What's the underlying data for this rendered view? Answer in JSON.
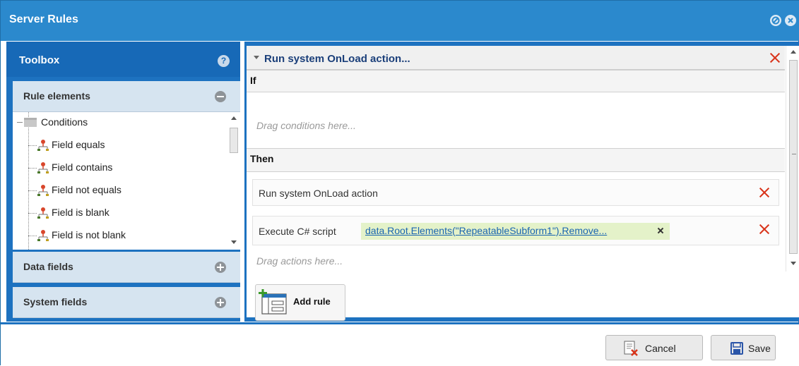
{
  "window": {
    "title": "Server Rules"
  },
  "toolbox": {
    "title": "Toolbox",
    "help_glyph": "?",
    "sections": {
      "rule_elements": "Rule elements",
      "data_fields": "Data fields",
      "system_fields": "System fields"
    },
    "tree": {
      "folder": "Conditions",
      "items": [
        "Field equals",
        "Field contains",
        "Field not equals",
        "Field is blank",
        "Field is not blank"
      ]
    }
  },
  "rule": {
    "name": "Run system OnLoad action...",
    "if_label": "If",
    "conditions_hint": "Drag conditions here...",
    "then_label": "Then",
    "actions": [
      {
        "label": "Run system OnLoad action"
      },
      {
        "label": "Execute C# script",
        "script": "data.Root.Elements(\"RepeatableSubform1\").Remove..."
      }
    ],
    "actions_hint": "Drag actions here..."
  },
  "add_rule_label": "Add rule",
  "footer": {
    "cancel_label": "Cancel",
    "save_label": "Save"
  },
  "colors": {
    "titlebar": "#2b89cd",
    "panel": "#1d72c0",
    "delete": "#d9341b",
    "script_chip": "#e4f2c9"
  }
}
